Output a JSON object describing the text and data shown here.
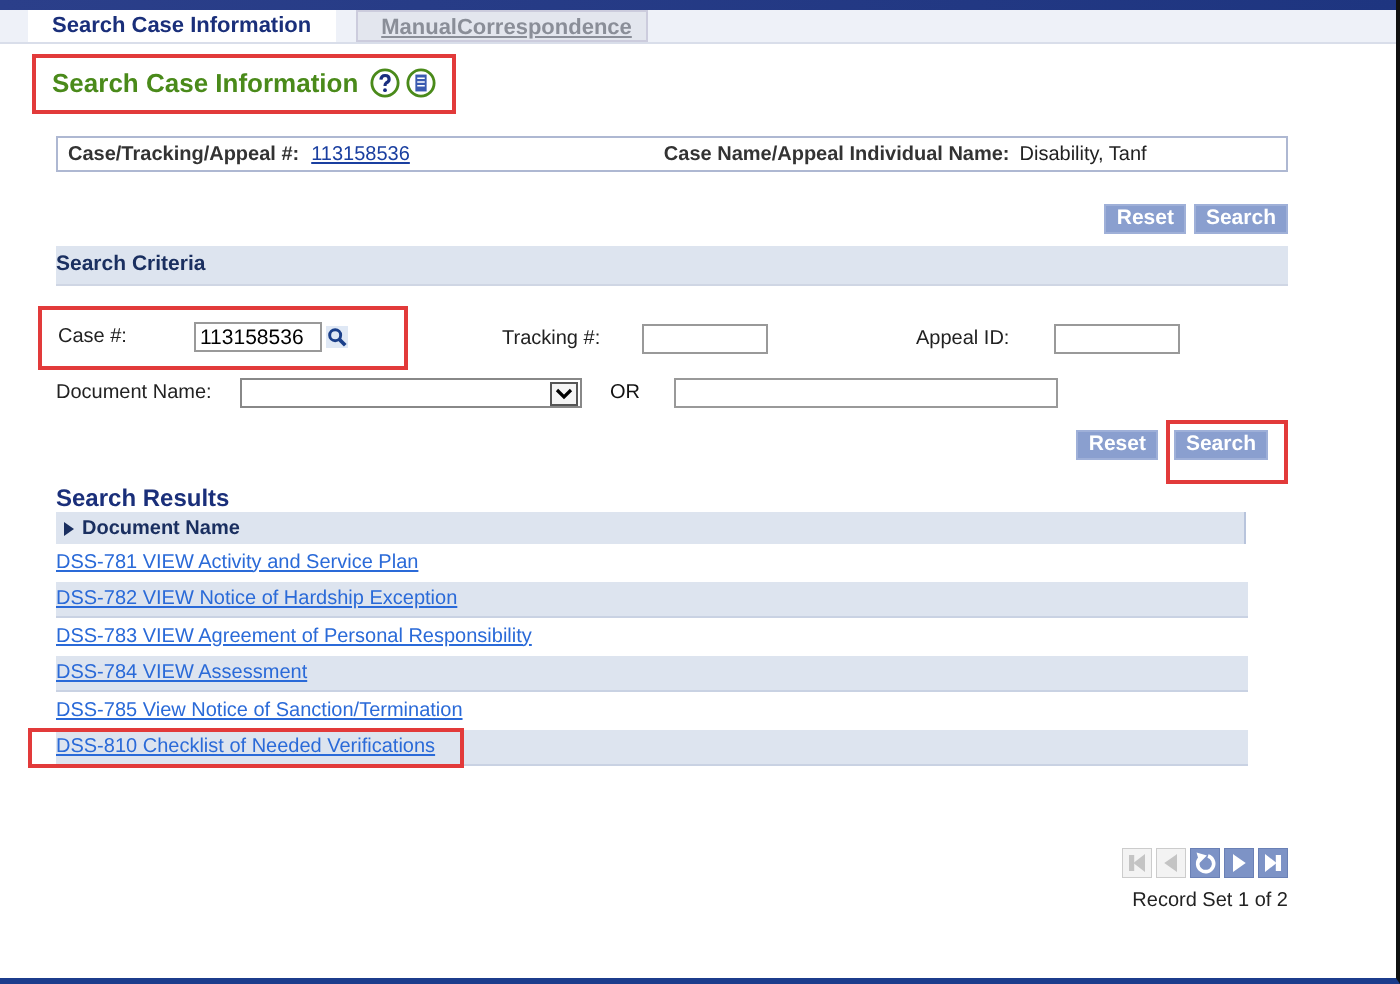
{
  "tabs": [
    {
      "label": "Search Case Information",
      "selected": true
    },
    {
      "label": "ManualCorrespondence",
      "selected": false
    }
  ],
  "page_title": {
    "text": "Search Case Information",
    "highlighted": true
  },
  "case_info": {
    "case_label": "Case/Tracking/Appeal #:",
    "case_number": "113158536",
    "name_label": "Case Name/Appeal Individual Name:",
    "name_value": "Disability, Tanf"
  },
  "top_buttons": [
    "Reset",
    "Search"
  ],
  "search_criteria": {
    "title": "Search Criteria",
    "case": {
      "label": "Case #:",
      "value": "113158536",
      "highlighted": true
    },
    "tracking": {
      "label": "Tracking #:"
    },
    "appeal": {
      "label": "Appeal ID:"
    },
    "document_name": {
      "label": "Document Name:"
    },
    "or_label": "OR"
  },
  "bottom_buttons": [
    {
      "label": "Reset",
      "highlighted": false
    },
    {
      "label": "Search",
      "highlighted": true
    }
  ],
  "results": {
    "title": "Search Results",
    "column": "Document Name",
    "rows": [
      {
        "text": "DSS-781 VIEW Activity and Service Plan",
        "highlighted": false
      },
      {
        "text": "DSS-782 VIEW Notice of Hardship Exception",
        "highlighted": false
      },
      {
        "text": "DSS-783 VIEW Agreement of Personal Responsibility",
        "highlighted": false
      },
      {
        "text": "DSS-784 VIEW Assessment",
        "highlighted": false
      },
      {
        "text": "DSS-785 View Notice of Sanction/Termination",
        "highlighted": false
      },
      {
        "text": "DSS-810 Checklist of Needed Verifications",
        "highlighted": true
      }
    ]
  },
  "pager": {
    "buttons": [
      {
        "kind": "first",
        "disabled": true
      },
      {
        "kind": "prev",
        "disabled": true
      },
      {
        "kind": "refresh",
        "disabled": false
      },
      {
        "kind": "next",
        "disabled": false
      },
      {
        "kind": "last",
        "disabled": false
      }
    ],
    "status": "Record Set 1 of 2"
  }
}
